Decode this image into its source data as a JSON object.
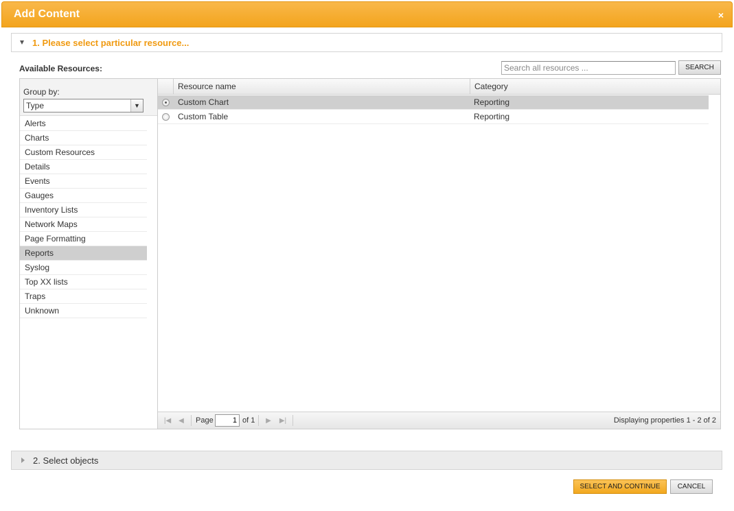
{
  "dialog": {
    "title": "Add Content",
    "close_glyph": "×"
  },
  "step1": {
    "label": "1. Please select particular resource..."
  },
  "available": {
    "label": "Available Resources:",
    "search_placeholder": "Search all resources ...",
    "search_button": "SEARCH"
  },
  "group_by": {
    "label": "Group by:",
    "selected": "Type",
    "items": [
      "Alerts",
      "Charts",
      "Custom Resources",
      "Details",
      "Events",
      "Gauges",
      "Inventory Lists",
      "Network Maps",
      "Page Formatting",
      "Reports",
      "Syslog",
      "Top XX lists",
      "Traps",
      "Unknown"
    ],
    "selected_item": "Reports"
  },
  "grid": {
    "columns": [
      "Resource name",
      "Category"
    ],
    "rows": [
      {
        "name": "Custom Chart",
        "category": "Reporting",
        "selected": true
      },
      {
        "name": "Custom Table",
        "category": "Reporting",
        "selected": false
      }
    ]
  },
  "pager": {
    "page_label": "Page",
    "page_value": "1",
    "of_label": "of 1",
    "display_text": "Displaying properties 1 - 2 of 2"
  },
  "step2": {
    "label": "2. Select objects"
  },
  "footer": {
    "primary_button": "SELECT AND CONTINUE",
    "cancel_button": "CANCEL"
  },
  "colors": {
    "accent": "#f3a41d",
    "step_title": "#f09a11",
    "selection": "#cfcfcf"
  }
}
